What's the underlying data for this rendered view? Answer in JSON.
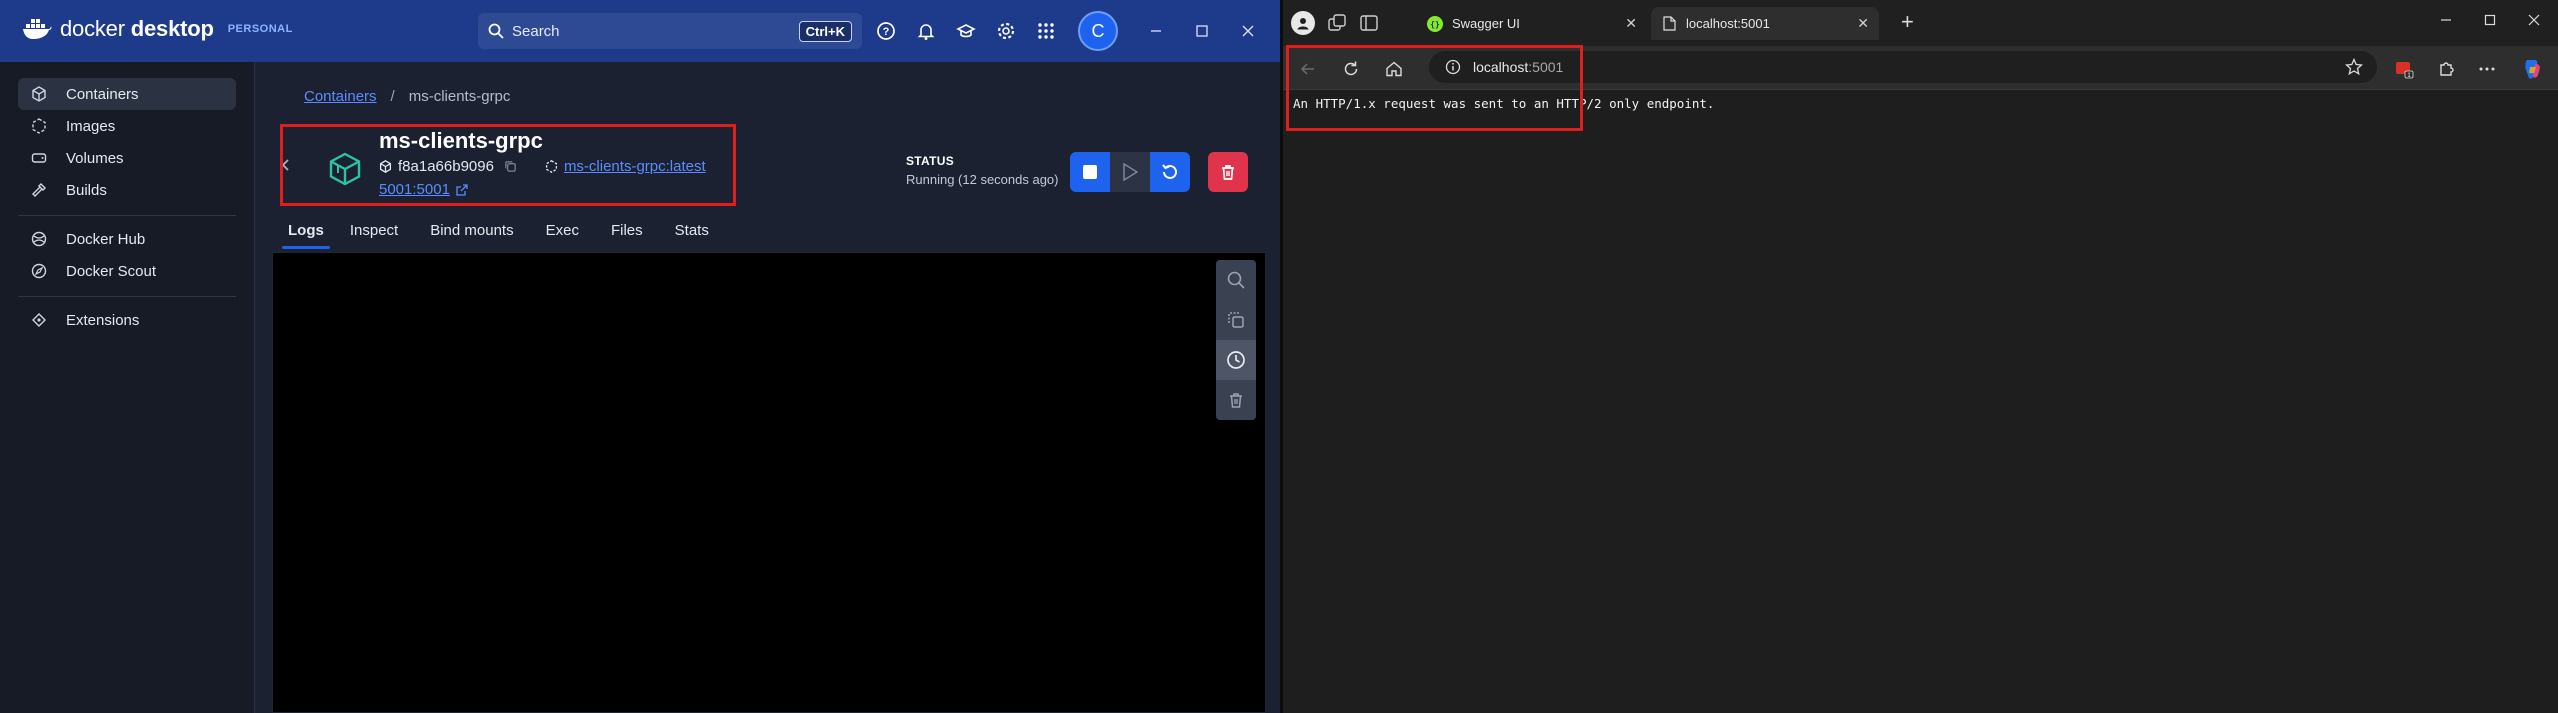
{
  "docker": {
    "brand_light": "docker",
    "brand_bold": "desktop",
    "plan": "PERSONAL",
    "search_label": "Search",
    "search_shortcut": "Ctrl+K",
    "avatar_initial": "C",
    "sidebar": {
      "items": [
        {
          "label": "Containers",
          "icon": "container-icon"
        },
        {
          "label": "Images",
          "icon": "images-icon"
        },
        {
          "label": "Volumes",
          "icon": "volumes-icon"
        },
        {
          "label": "Builds",
          "icon": "builds-icon"
        },
        {
          "label": "Docker Hub",
          "icon": "docker-hub-icon"
        },
        {
          "label": "Docker Scout",
          "icon": "docker-scout-icon"
        },
        {
          "label": "Extensions",
          "icon": "extensions-icon"
        }
      ]
    },
    "breadcrumb": {
      "root": "Containers",
      "sep": "/",
      "current": "ms-clients-grpc"
    },
    "container": {
      "name": "ms-clients-grpc",
      "id": "f8a1a66b9096",
      "image": "ms-clients-grpc:latest",
      "port": "5001:5001"
    },
    "status": {
      "heading": "STATUS",
      "value": "Running (12 seconds ago)"
    },
    "tabs": [
      "Logs",
      "Inspect",
      "Bind mounts",
      "Exec",
      "Files",
      "Stats"
    ],
    "colors": {
      "titlebar": "#1e3a8a",
      "accent": "#1d63ed",
      "danger": "#e0344c",
      "highlight_box": "#e01e1e"
    }
  },
  "browser": {
    "tabs": [
      {
        "title": "Swagger UI",
        "icon": "swagger-icon"
      },
      {
        "title": "localhost:5001",
        "icon": "page-icon"
      }
    ],
    "address": {
      "host": "localhost",
      "port": ":5001"
    },
    "page_message": "An HTTP/1.x request was sent to an HTTP/2 only endpoint."
  }
}
